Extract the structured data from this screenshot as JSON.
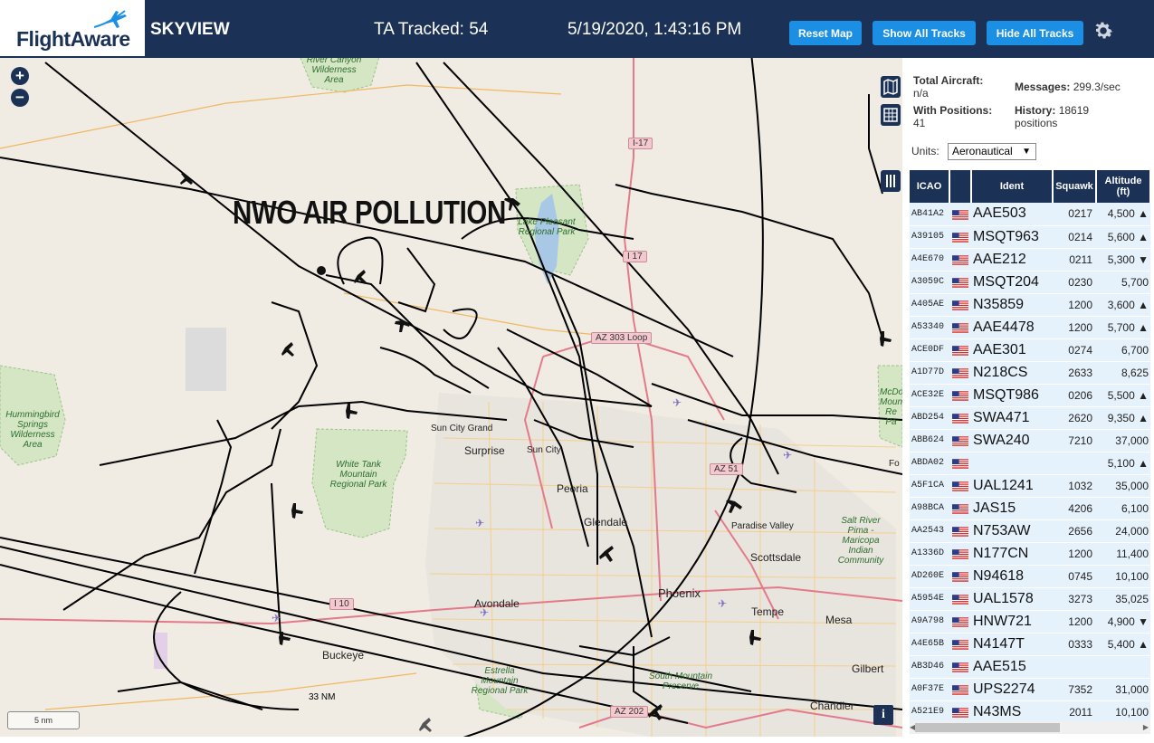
{
  "header": {
    "logo_text": "FlightAware",
    "app_title": "SKYVIEW",
    "tracked": "TA Tracked: 54",
    "timestamp": "5/19/2020, 1:43:16 PM",
    "reset_label": "Reset Map",
    "show_label": "Show All Tracks",
    "hide_label": "Hide All Tracks",
    "settings_icon": "gear-icon"
  },
  "map": {
    "overlay_text": "NWO AIR POLLUTION",
    "zoom_in": "+",
    "zoom_out": "−",
    "scale_label": "5 nm",
    "range_label": "33 NM",
    "info_label": "i",
    "parks": [
      "River Canyon Wilderness Area",
      "Hummingbird Springs Wilderness Area",
      "White Tank Mountain Regional Park",
      "Lake Pleasant Regional Park",
      "Estrella Mountain Regional Park",
      "South Mountain Preserve",
      "Salt River Pima - Maricopa Indian Community",
      "McDo Moun Re Pa"
    ],
    "cities": [
      "Sun City Grand",
      "Surprise",
      "Sun City",
      "Peoria",
      "Glendale",
      "Paradise Valley",
      "Scottsdale",
      "Phoenix",
      "Tempe",
      "Mesa",
      "Gilbert",
      "Chandler",
      "Avondale",
      "Buckeye",
      "Fo"
    ],
    "roads": [
      "I-17",
      "I 17",
      "AZ 303 Loop",
      "AZ 51",
      "I 10",
      "AZ 202"
    ]
  },
  "panel": {
    "total_aircraft_label": "Total Aircraft:",
    "total_aircraft_value": "n/a",
    "with_positions_label": "With Positions:",
    "with_positions_value": "41",
    "messages_label": "Messages:",
    "messages_value": "299.3/sec",
    "history_label": "History:",
    "history_value": "18619",
    "history_unit": "positions",
    "units_label": "Units:",
    "units_value": "Aeronautical",
    "columns": [
      "ICAO",
      "",
      "Ident",
      "Squawk",
      "Altitude (ft)"
    ],
    "rows": [
      {
        "icao": "AB41A2",
        "ident": "AAE503",
        "squawk": "0217",
        "alt": "4,500 ▲"
      },
      {
        "icao": "A39105",
        "ident": "MSQT963",
        "squawk": "0214",
        "alt": "5,600 ▲"
      },
      {
        "icao": "A4E670",
        "ident": "AAE212",
        "squawk": "0211",
        "alt": "5,300 ▼"
      },
      {
        "icao": "A3059C",
        "ident": "MSQT204",
        "squawk": "0230",
        "alt": "5,700"
      },
      {
        "icao": "A405AE",
        "ident": "N35859",
        "squawk": "1200",
        "alt": "3,600 ▲"
      },
      {
        "icao": "A53340",
        "ident": "AAE4478",
        "squawk": "1200",
        "alt": "5,700 ▲"
      },
      {
        "icao": "ACE0DF",
        "ident": "AAE301",
        "squawk": "0274",
        "alt": "6,700"
      },
      {
        "icao": "A1D77D",
        "ident": "N218CS",
        "squawk": "2633",
        "alt": "8,625"
      },
      {
        "icao": "ACE32E",
        "ident": "MSQT986",
        "squawk": "0206",
        "alt": "5,500 ▲"
      },
      {
        "icao": "ABD254",
        "ident": "SWA471",
        "squawk": "2620",
        "alt": "9,350 ▲"
      },
      {
        "icao": "ABB624",
        "ident": "SWA240",
        "squawk": "7210",
        "alt": "37,000"
      },
      {
        "icao": "ABDA02",
        "ident": "",
        "squawk": "",
        "alt": "5,100 ▲"
      },
      {
        "icao": "A5F1CA",
        "ident": "UAL1241",
        "squawk": "1032",
        "alt": "35,000"
      },
      {
        "icao": "A98BCA",
        "ident": "JAS15",
        "squawk": "4206",
        "alt": "6,100"
      },
      {
        "icao": "AA2543",
        "ident": "N753AW",
        "squawk": "2656",
        "alt": "24,000"
      },
      {
        "icao": "A1336D",
        "ident": "N177CN",
        "squawk": "1200",
        "alt": "11,400"
      },
      {
        "icao": "AD260E",
        "ident": "N94618",
        "squawk": "0745",
        "alt": "10,100"
      },
      {
        "icao": "A5954E",
        "ident": "UAL1578",
        "squawk": "3273",
        "alt": "35,025"
      },
      {
        "icao": "A9A798",
        "ident": "HNW721",
        "squawk": "1200",
        "alt": "4,900 ▼"
      },
      {
        "icao": "A4E65B",
        "ident": "N4147T",
        "squawk": "0333",
        "alt": "5,400 ▲"
      },
      {
        "icao": "AB3D46",
        "ident": "AAE515",
        "squawk": "",
        "alt": ""
      },
      {
        "icao": "A0F37E",
        "ident": "UPS2274",
        "squawk": "7352",
        "alt": "31,000"
      },
      {
        "icao": "A521E9",
        "ident": "N43MS",
        "squawk": "2011",
        "alt": "10,100"
      }
    ]
  },
  "colors": {
    "header_bg": "#1b3155",
    "button_bg": "#1a8fe3",
    "row_bg": "#e5f1fb",
    "map_bg": "#f0ece3",
    "track": "#000000"
  }
}
